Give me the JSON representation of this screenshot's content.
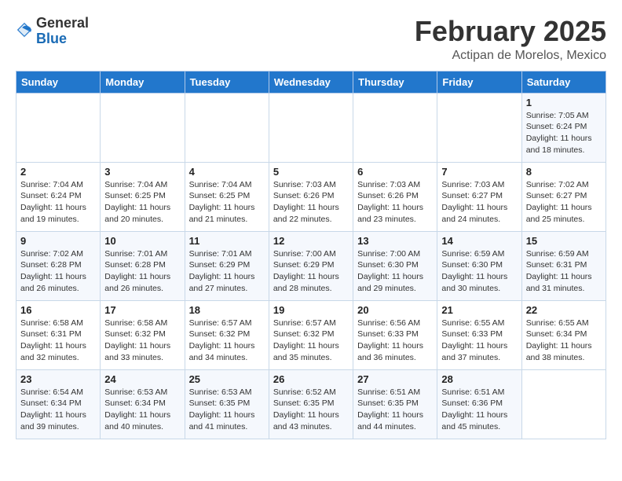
{
  "header": {
    "logo_general": "General",
    "logo_blue": "Blue",
    "month_title": "February 2025",
    "subtitle": "Actipan de Morelos, Mexico"
  },
  "weekdays": [
    "Sunday",
    "Monday",
    "Tuesday",
    "Wednesday",
    "Thursday",
    "Friday",
    "Saturday"
  ],
  "weeks": [
    [
      {
        "day": "",
        "info": ""
      },
      {
        "day": "",
        "info": ""
      },
      {
        "day": "",
        "info": ""
      },
      {
        "day": "",
        "info": ""
      },
      {
        "day": "",
        "info": ""
      },
      {
        "day": "",
        "info": ""
      },
      {
        "day": "1",
        "info": "Sunrise: 7:05 AM\nSunset: 6:24 PM\nDaylight: 11 hours\nand 18 minutes."
      }
    ],
    [
      {
        "day": "2",
        "info": "Sunrise: 7:04 AM\nSunset: 6:24 PM\nDaylight: 11 hours\nand 19 minutes."
      },
      {
        "day": "3",
        "info": "Sunrise: 7:04 AM\nSunset: 6:25 PM\nDaylight: 11 hours\nand 20 minutes."
      },
      {
        "day": "4",
        "info": "Sunrise: 7:04 AM\nSunset: 6:25 PM\nDaylight: 11 hours\nand 21 minutes."
      },
      {
        "day": "5",
        "info": "Sunrise: 7:03 AM\nSunset: 6:26 PM\nDaylight: 11 hours\nand 22 minutes."
      },
      {
        "day": "6",
        "info": "Sunrise: 7:03 AM\nSunset: 6:26 PM\nDaylight: 11 hours\nand 23 minutes."
      },
      {
        "day": "7",
        "info": "Sunrise: 7:03 AM\nSunset: 6:27 PM\nDaylight: 11 hours\nand 24 minutes."
      },
      {
        "day": "8",
        "info": "Sunrise: 7:02 AM\nSunset: 6:27 PM\nDaylight: 11 hours\nand 25 minutes."
      }
    ],
    [
      {
        "day": "9",
        "info": "Sunrise: 7:02 AM\nSunset: 6:28 PM\nDaylight: 11 hours\nand 26 minutes."
      },
      {
        "day": "10",
        "info": "Sunrise: 7:01 AM\nSunset: 6:28 PM\nDaylight: 11 hours\nand 26 minutes."
      },
      {
        "day": "11",
        "info": "Sunrise: 7:01 AM\nSunset: 6:29 PM\nDaylight: 11 hours\nand 27 minutes."
      },
      {
        "day": "12",
        "info": "Sunrise: 7:00 AM\nSunset: 6:29 PM\nDaylight: 11 hours\nand 28 minutes."
      },
      {
        "day": "13",
        "info": "Sunrise: 7:00 AM\nSunset: 6:30 PM\nDaylight: 11 hours\nand 29 minutes."
      },
      {
        "day": "14",
        "info": "Sunrise: 6:59 AM\nSunset: 6:30 PM\nDaylight: 11 hours\nand 30 minutes."
      },
      {
        "day": "15",
        "info": "Sunrise: 6:59 AM\nSunset: 6:31 PM\nDaylight: 11 hours\nand 31 minutes."
      }
    ],
    [
      {
        "day": "16",
        "info": "Sunrise: 6:58 AM\nSunset: 6:31 PM\nDaylight: 11 hours\nand 32 minutes."
      },
      {
        "day": "17",
        "info": "Sunrise: 6:58 AM\nSunset: 6:32 PM\nDaylight: 11 hours\nand 33 minutes."
      },
      {
        "day": "18",
        "info": "Sunrise: 6:57 AM\nSunset: 6:32 PM\nDaylight: 11 hours\nand 34 minutes."
      },
      {
        "day": "19",
        "info": "Sunrise: 6:57 AM\nSunset: 6:32 PM\nDaylight: 11 hours\nand 35 minutes."
      },
      {
        "day": "20",
        "info": "Sunrise: 6:56 AM\nSunset: 6:33 PM\nDaylight: 11 hours\nand 36 minutes."
      },
      {
        "day": "21",
        "info": "Sunrise: 6:55 AM\nSunset: 6:33 PM\nDaylight: 11 hours\nand 37 minutes."
      },
      {
        "day": "22",
        "info": "Sunrise: 6:55 AM\nSunset: 6:34 PM\nDaylight: 11 hours\nand 38 minutes."
      }
    ],
    [
      {
        "day": "23",
        "info": "Sunrise: 6:54 AM\nSunset: 6:34 PM\nDaylight: 11 hours\nand 39 minutes."
      },
      {
        "day": "24",
        "info": "Sunrise: 6:53 AM\nSunset: 6:34 PM\nDaylight: 11 hours\nand 40 minutes."
      },
      {
        "day": "25",
        "info": "Sunrise: 6:53 AM\nSunset: 6:35 PM\nDaylight: 11 hours\nand 41 minutes."
      },
      {
        "day": "26",
        "info": "Sunrise: 6:52 AM\nSunset: 6:35 PM\nDaylight: 11 hours\nand 43 minutes."
      },
      {
        "day": "27",
        "info": "Sunrise: 6:51 AM\nSunset: 6:35 PM\nDaylight: 11 hours\nand 44 minutes."
      },
      {
        "day": "28",
        "info": "Sunrise: 6:51 AM\nSunset: 6:36 PM\nDaylight: 11 hours\nand 45 minutes."
      },
      {
        "day": "",
        "info": ""
      }
    ]
  ]
}
